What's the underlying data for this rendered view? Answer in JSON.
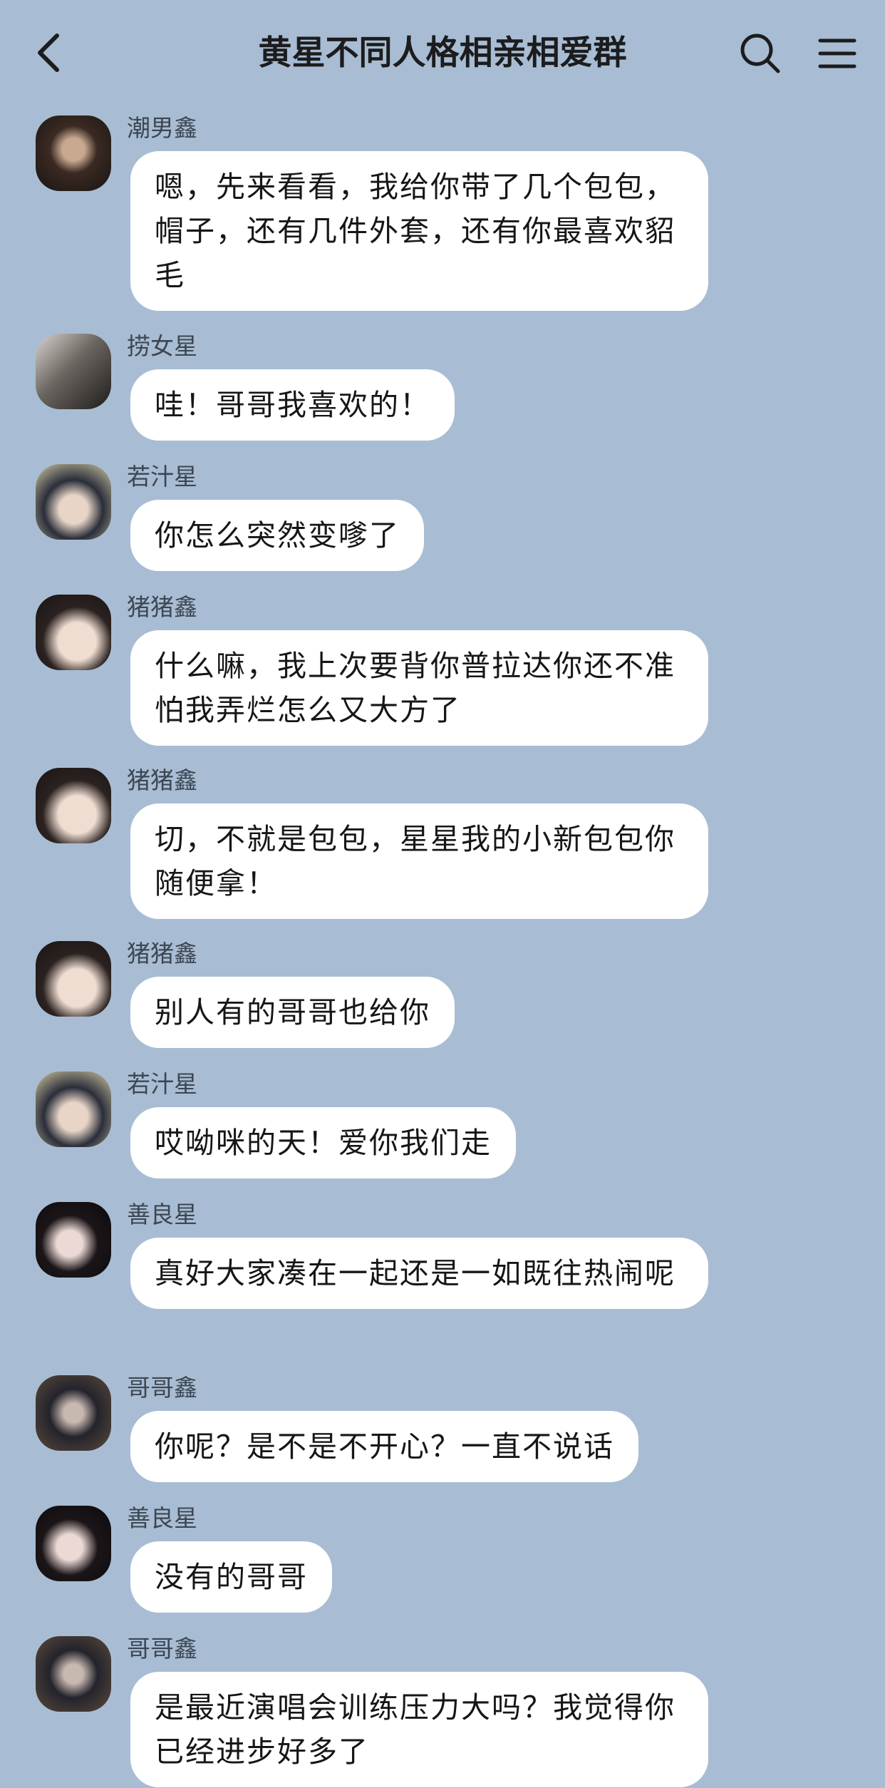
{
  "header": {
    "title": "黄星不同人格相亲相爱群"
  },
  "icons": {
    "back": "chevron-left-icon",
    "search": "search-icon",
    "menu": "menu-icon"
  },
  "colors": {
    "background": "#a8bdd3",
    "bubble": "#ffffff",
    "text": "#161616",
    "sender": "#3d4653"
  },
  "messages": [
    {
      "sender": "潮男鑫",
      "text": "嗯，先来看看，我给你带了几个包包，帽子，还有几件外套，还有你最喜欢貂毛"
    },
    {
      "sender": "捞女星",
      "text": "哇！哥哥我喜欢的！"
    },
    {
      "sender": "若汁星",
      "text": "你怎么突然变嗲了"
    },
    {
      "sender": "猪猪鑫",
      "text": "什么嘛，我上次要背你普拉达你还不准怕我弄烂怎么又大方了"
    },
    {
      "sender": "猪猪鑫",
      "text": "切，不就是包包，星星我的小新包包你随便拿！"
    },
    {
      "sender": "猪猪鑫",
      "text": "别人有的哥哥也给你"
    },
    {
      "sender": "若汁星",
      "text": "哎呦咪的天！爱你我们走"
    },
    {
      "sender": "善良星",
      "text": "真好大家凑在一起还是一如既往热闹呢"
    },
    {
      "sender": "哥哥鑫",
      "text": "你呢？是不是不开心？一直不说话"
    },
    {
      "sender": "善良星",
      "text": "没有的哥哥"
    },
    {
      "sender": "哥哥鑫",
      "text": "是最近演唱会训练压力大吗？我觉得你已经进步好多了"
    }
  ]
}
